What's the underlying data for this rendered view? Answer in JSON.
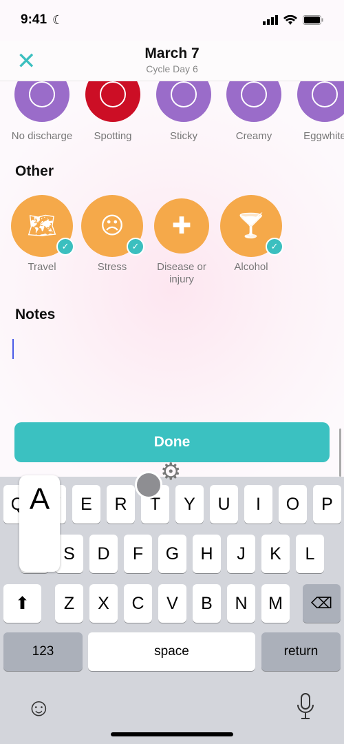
{
  "status": {
    "time": "9:41"
  },
  "header": {
    "title": "March 7",
    "subtitle": "Cycle Day 6"
  },
  "discharge": [
    {
      "label": "No discharge",
      "color": "#9a6cc9",
      "selected": false
    },
    {
      "label": "Spotting",
      "color": "#cc0e25",
      "selected": true
    },
    {
      "label": "Sticky",
      "color": "#9a6cc9",
      "selected": false
    },
    {
      "label": "Creamy",
      "color": "#9a6cc9",
      "selected": false
    },
    {
      "label": "Eggwhite",
      "color": "#9a6cc9",
      "selected": false
    }
  ],
  "other": {
    "title": "Other",
    "items": [
      {
        "label": "Travel",
        "icon": "map-pin-globe-icon",
        "checked": true
      },
      {
        "label": "Stress",
        "icon": "stressed-face-icon",
        "checked": true
      },
      {
        "label": "Disease or injury",
        "icon": "medicine-bottle-icon",
        "checked": false
      },
      {
        "label": "Alcohol",
        "icon": "cocktail-icon",
        "checked": true
      }
    ],
    "color": "#f5a94a"
  },
  "notes": {
    "title": "Notes",
    "value": ""
  },
  "done_label": "Done",
  "keyboard": {
    "row1": [
      "Q",
      "W",
      "E",
      "R",
      "T",
      "Y",
      "U",
      "I",
      "O",
      "P"
    ],
    "row2": [
      "A",
      "S",
      "D",
      "F",
      "G",
      "H",
      "J",
      "K",
      "L"
    ],
    "row3": [
      "Z",
      "X",
      "C",
      "V",
      "B",
      "N",
      "M"
    ],
    "numbers": "123",
    "space": "space",
    "return": "return",
    "popup": "A"
  },
  "accent": "#3bc1c1"
}
